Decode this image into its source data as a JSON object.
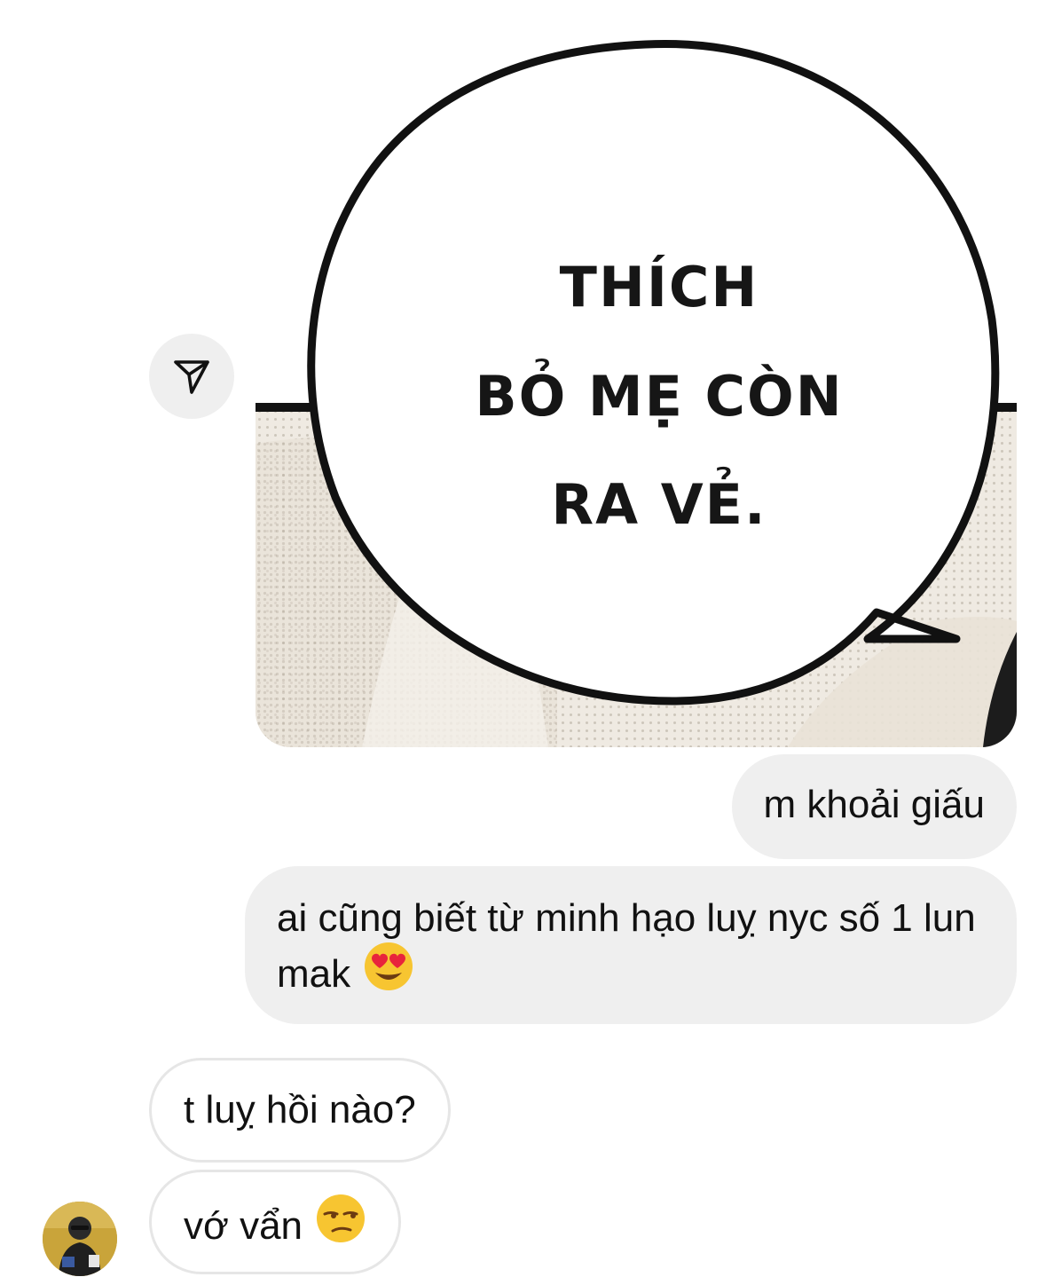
{
  "shared_image": {
    "bubble_lines": [
      "THÍCH",
      "BỎ MẸ CÒN",
      "RA VẺ."
    ]
  },
  "forward": {
    "icon": "paper-plane-icon"
  },
  "messages": [
    {
      "sender": "me",
      "text": "m khoải giấu",
      "emoji": ""
    },
    {
      "sender": "me",
      "text": "ai cũng biết từ minh hạo luỵ nyc số 1 lun mak",
      "emoji": "heart-eyes-emoji"
    },
    {
      "sender": "them",
      "text": "t luỵ hồi nào?",
      "emoji": ""
    },
    {
      "sender": "them",
      "text": "vớ vẩn",
      "emoji": "unamused-emoji"
    }
  ],
  "colors": {
    "sent_bubble": "#efefef",
    "received_border": "#e6e6e6",
    "emoji_face": "#f7c531"
  }
}
